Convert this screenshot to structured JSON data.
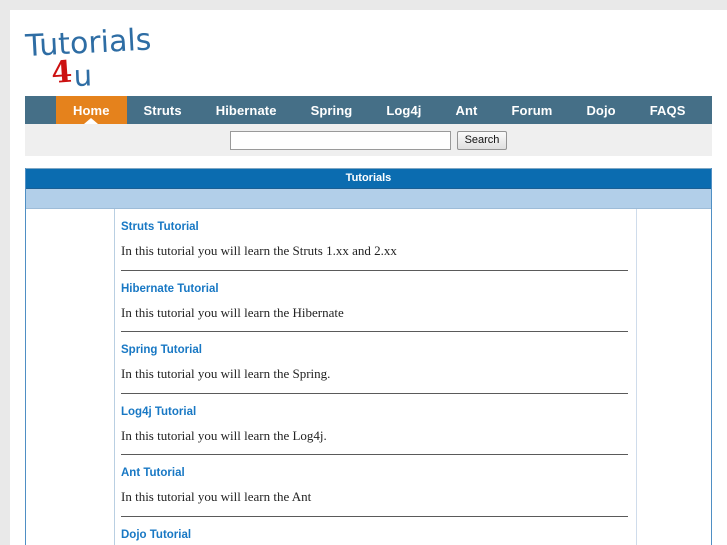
{
  "site": {
    "logo_line1": "Tutorials",
    "logo_accent": "4",
    "logo_line2": "u",
    "logo_color_blue": "#2e6da4",
    "logo_color_red": "#cc1111"
  },
  "nav": {
    "bar_color": "#456f87",
    "active_color": "#e5821c",
    "items": [
      {
        "label": "Home",
        "active": true
      },
      {
        "label": "Struts",
        "active": false
      },
      {
        "label": "Hibernate",
        "active": false
      },
      {
        "label": "Spring",
        "active": false
      },
      {
        "label": "Log4j",
        "active": false
      },
      {
        "label": "Ant",
        "active": false
      },
      {
        "label": "Forum",
        "active": false
      },
      {
        "label": "Dojo",
        "active": false
      },
      {
        "label": "FAQS",
        "active": false
      }
    ]
  },
  "search": {
    "value": "",
    "placeholder": "",
    "button_label": "Search"
  },
  "panel": {
    "title": "Tutorials",
    "title_color": "#0b6cb0",
    "subbar_color": "#b2cfe9"
  },
  "tutorials": [
    {
      "title": "Struts Tutorial",
      "desc": "In this tutorial you will learn the Struts 1.xx and 2.xx"
    },
    {
      "title": "Hibernate Tutorial",
      "desc": "In this tutorial you will learn the Hibernate"
    },
    {
      "title": "Spring Tutorial",
      "desc": "In this tutorial you will learn the Spring."
    },
    {
      "title": "Log4j Tutorial",
      "desc": "In this tutorial you will learn the Log4j."
    },
    {
      "title": "Ant Tutorial",
      "desc": "In this tutorial you will learn the Ant"
    },
    {
      "title": "Dojo Tutorial",
      "desc": ""
    }
  ]
}
